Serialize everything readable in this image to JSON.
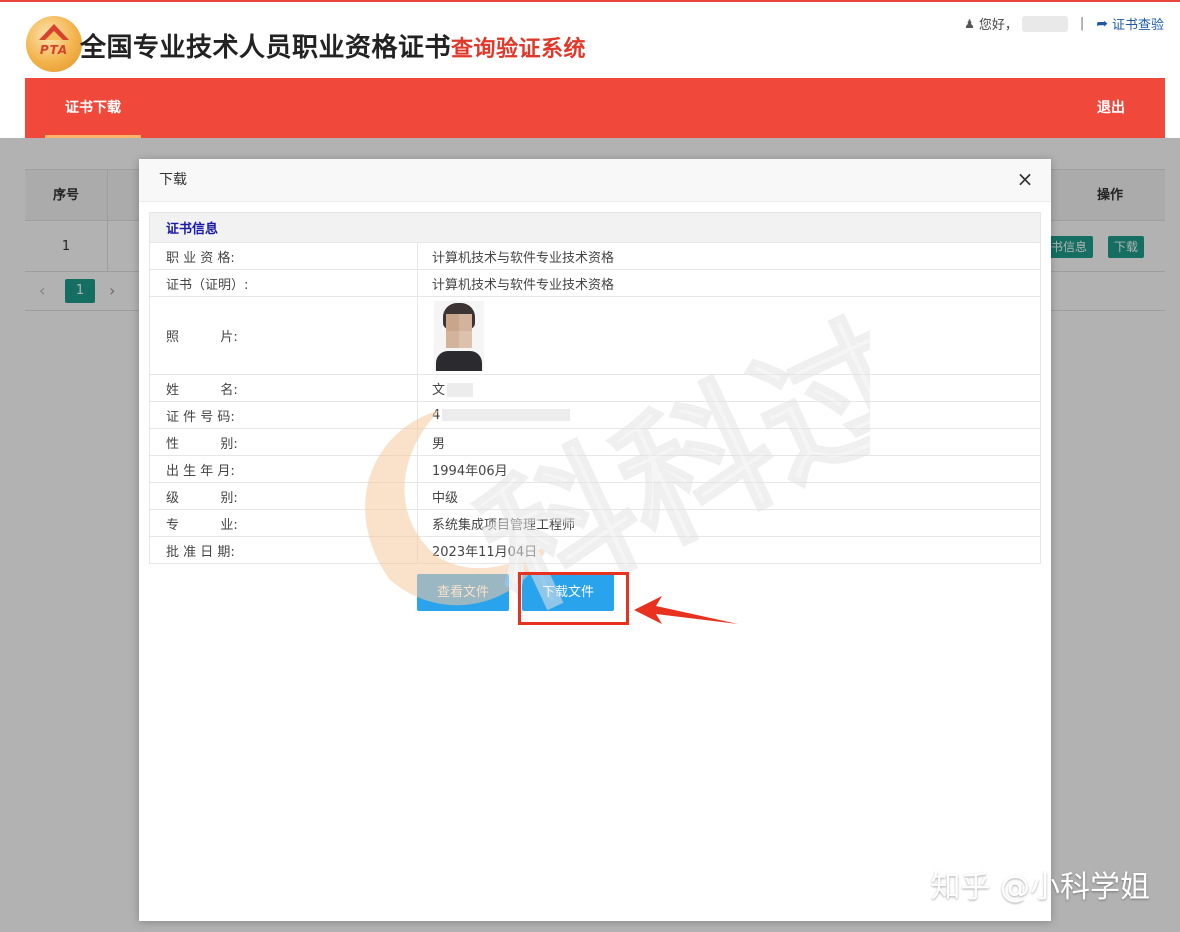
{
  "header": {
    "logo_text": "PTA",
    "title_main": "全国专业技术人员职业资格证书",
    "title_sub": "查询验证系统",
    "greeting": "您好，",
    "separator": "|",
    "verify_link": "证书查验"
  },
  "nav": {
    "tab_label": "证书下载",
    "logout_label": "退出"
  },
  "background_table": {
    "col_no": "序号",
    "col_op": "操作",
    "row_no": "1",
    "btn_info": "书信息",
    "btn_download": "下载",
    "page_current": "1",
    "prev_glyph": "‹",
    "next_glyph": "›"
  },
  "modal": {
    "title": "下载",
    "close_glyph": "×",
    "section_title": "证书信息",
    "rows": [
      {
        "label": "职 业 资 格:",
        "value": "计算机技术与软件专业技术资格"
      },
      {
        "label": "证书（证明）:",
        "value": "计算机技术与软件专业技术资格"
      },
      {
        "label": "照          片:",
        "value": ""
      },
      {
        "label": "姓          名:",
        "value": "文"
      },
      {
        "label": "证 件 号 码:",
        "value": "4"
      },
      {
        "label": "性          别:",
        "value": "男"
      },
      {
        "label": "出 生 年 月:",
        "value": "1994年06月"
      },
      {
        "label": "级          别:",
        "value": "中级"
      },
      {
        "label": "专          业:",
        "value": "系统集成项目管理工程师"
      },
      {
        "label": "批 准 日 期:",
        "value": "2023年11月04日"
      }
    ],
    "btn_view": "查看文件",
    "btn_download": "下载文件"
  },
  "watermark": {
    "text": "科科过",
    "brand": "知乎 @小科学姐"
  },
  "colors": {
    "nav_red": "#f0493c",
    "teal": "#1e9e8c",
    "blue_button": "#2aa3ed",
    "highlight_red": "#e8311f"
  }
}
